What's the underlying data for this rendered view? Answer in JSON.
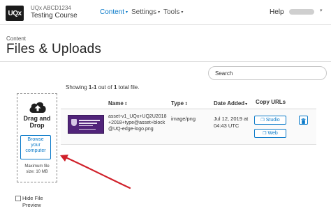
{
  "header": {
    "logo_text": "UQx",
    "course_org": "UQx ABCD1234",
    "course_title": "Testing Course",
    "nav": [
      {
        "label": "Content",
        "active": true
      },
      {
        "label": "Settings",
        "active": false
      },
      {
        "label": "Tools",
        "active": false
      }
    ],
    "help_label": "Help",
    "caret": "▾"
  },
  "page": {
    "breadcrumb": "Content",
    "title": "Files & Uploads"
  },
  "search": {
    "placeholder": "Search"
  },
  "listing": {
    "showing_prefix": "Showing ",
    "showing_range": "1-1",
    "showing_middle": " out of ",
    "showing_total": "1",
    "showing_suffix": " total file."
  },
  "dropzone": {
    "label_line1": "Drag and",
    "label_line2": "Drop",
    "browse_line1": "Browse",
    "browse_line2": "your",
    "browse_line3": "computer",
    "max_line1": "Maximum file",
    "max_line2": "size: 10 MB"
  },
  "table": {
    "columns": {
      "name": "Name",
      "type": "Type",
      "date": "Date Added",
      "copy": "Copy URLs"
    },
    "sort_icon": "⇕",
    "sort_active_icon": "▾",
    "rows": [
      {
        "name": "asset-v1_UQx+UQ2U2018+2018+type@asset+block@UQ-edge-logo.png",
        "type": "image/png",
        "date_line1": "Jul 12, 2019 at",
        "date_line2": "04:43 UTC",
        "studio_label": "Studio",
        "web_label": "Web"
      }
    ]
  },
  "hide_preview": {
    "line1": "Hide File",
    "line2": "Preview"
  },
  "colors": {
    "accent": "#0a7ac9",
    "annotation": "#d0202a",
    "thumbnail": "#51247a"
  }
}
